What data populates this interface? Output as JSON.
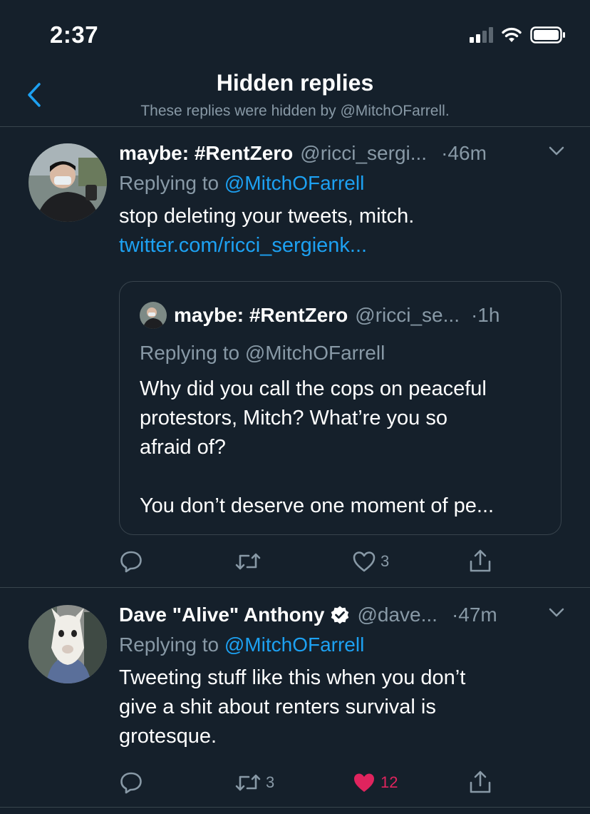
{
  "status_bar": {
    "time": "2:37"
  },
  "header": {
    "title": "Hidden replies",
    "subtitle": "These replies were hidden by @MitchOFarrell."
  },
  "tweets": [
    {
      "name": "maybe: #RentZero",
      "handle": "@ricci_sergi...",
      "time": "·46m",
      "replying_prefix": "Replying to ",
      "replying_to": "@MitchOFarrell",
      "text": "stop deleting your tweets, mitch.",
      "link": "twitter.com/ricci_sergienk...",
      "quote": {
        "name": "maybe: #RentZero",
        "handle": "@ricci_se...",
        "time": "·1h",
        "replying_prefix": "Replying to ",
        "replying_to": "@MitchOFarrell",
        "text_lines": [
          "Why did you call the cops on peaceful",
          "protestors, Mitch? What’re you so",
          "afraid of?",
          "",
          "You don’t deserve one moment of pe..."
        ]
      },
      "actions": {
        "reply_count": "",
        "retweet_count": "",
        "like_count": "3",
        "liked": false
      }
    },
    {
      "name": "Dave \"Alive\" Anthony",
      "verified": true,
      "handle": "@dave...",
      "time": "·47m",
      "replying_prefix": "Replying to ",
      "replying_to": "@MitchOFarrell",
      "text_lines": [
        "Tweeting stuff like this when you don’t",
        "give a shit about renters survival is",
        "grotesque."
      ],
      "actions": {
        "reply_count": "",
        "retweet_count": "3",
        "like_count": "12",
        "liked": true
      }
    }
  ],
  "colors": {
    "background": "#15202b",
    "accent": "#1da1f2",
    "secondary_text": "#8899a6",
    "divider": "#38444d",
    "like": "#e0245e"
  },
  "icons": [
    "back-chevron-icon",
    "chevron-down-icon",
    "reply-icon",
    "retweet-icon",
    "like-icon",
    "share-icon",
    "verified-badge-icon",
    "signal-icon",
    "wifi-icon",
    "battery-icon"
  ]
}
